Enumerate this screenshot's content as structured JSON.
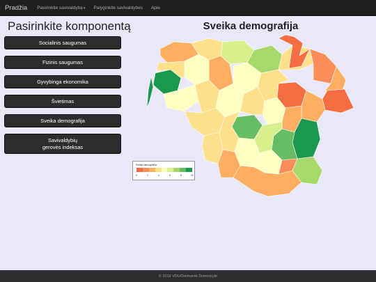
{
  "nav": {
    "brand": "Pradžia",
    "items": [
      "Pasirinkite savivaldybę",
      "Palyginkite savivaldybes",
      "Apie"
    ]
  },
  "sidebar": {
    "title": "Pasirinkite komponentą",
    "buttons": [
      "Socialinis saugumas",
      "Fizinis saugumas",
      "Gyvybinga ekonomika",
      "Švietimas",
      "Sveika demografija",
      "Savivaldybių gerovės indeksas"
    ]
  },
  "map": {
    "title": "Sveika demografija",
    "legend": {
      "title": "Sveika demografija",
      "ticks": [
        "0",
        "2",
        "4",
        "6",
        "8",
        "10"
      ],
      "colors": [
        "#f46d43",
        "#fc8d59",
        "#fdae61",
        "#fee08b",
        "#ffffbf",
        "#d9ef8b",
        "#a6d96a",
        "#66bd63",
        "#1a9850"
      ]
    }
  },
  "footer": {
    "text": "© 2019 VDU/Deimantė Žemeckytė"
  }
}
